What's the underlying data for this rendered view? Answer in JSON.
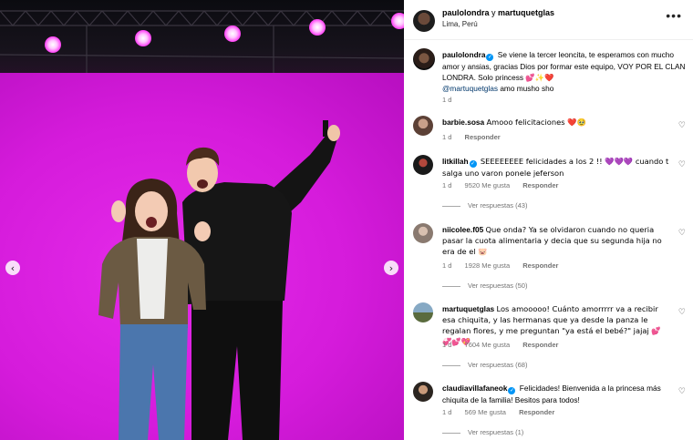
{
  "post": {
    "author": "paulolondra",
    "conjunction": "y",
    "collaborator": "martuquetglas",
    "location": "Lima, Perú",
    "more_icon": "more-horizontal-icon"
  },
  "caption": {
    "username": "paulolondra",
    "text": "Se viene la tercer leoncita, te esperamos con mucho amor y ansias, gracias Dios por formar este equipo, VOY POR EL CLAN LONDRA. Solo princess 💕✨❤️",
    "mention": "@martuquetglas",
    "mention_suffix": "amo musho sho",
    "time": "1 d"
  },
  "comments": [
    {
      "username": "barbie.sosa",
      "verified": false,
      "text": "Amooo felicitaciones ❤️🥹",
      "time": "1 d",
      "likes": "",
      "reply_label": "Responder",
      "replies": ""
    },
    {
      "username": "litkillah",
      "verified": true,
      "text": "SEEEEEEEE felicidades a los 2 !! 💜💜💜 cuando t salga uno varon ponele jeferson",
      "time": "1 d",
      "likes": "9520 Me gusta",
      "reply_label": "Responder",
      "replies": "Ver respuestas (43)"
    },
    {
      "username": "niicolee.f05",
      "verified": false,
      "text": "Que onda? Ya se olvidaron cuando no queria pasar la cuota alimentaria y decia que su segunda hija no era de el 🐷",
      "time": "1 d",
      "likes": "1928 Me gusta",
      "reply_label": "Responder",
      "replies": "Ver respuestas (50)"
    },
    {
      "username": "martuquetglas",
      "verified": false,
      "text": "Los amooooo! Cuánto amorrrrr va a recibir esa chiquita, y las hermanas que ya desde la panza le regalan flores, y me preguntan \"ya está el bebé?\" jajaj 💕💞💕💖",
      "time": "1 d",
      "likes": "7604 Me gusta",
      "reply_label": "Responder",
      "replies": "Ver respuestas (68)"
    },
    {
      "username": "claudiavillafaneok",
      "verified": true,
      "text": "Felicidades! Bienvenida a la princesa más chiquita de la familia! Besitos para todos!",
      "time": "1 d",
      "likes": "569 Me gusta",
      "reply_label": "Responder",
      "replies": "Ver respuestas (1)"
    }
  ],
  "nav": {
    "prev_icon": "chevron-left-icon",
    "next_icon": "chevron-right-icon"
  },
  "colors": {
    "stage_magenta": "#d21ad8",
    "verified_blue": "#0095f6",
    "meta_gray": "#737373",
    "mention_blue": "#00376b"
  }
}
